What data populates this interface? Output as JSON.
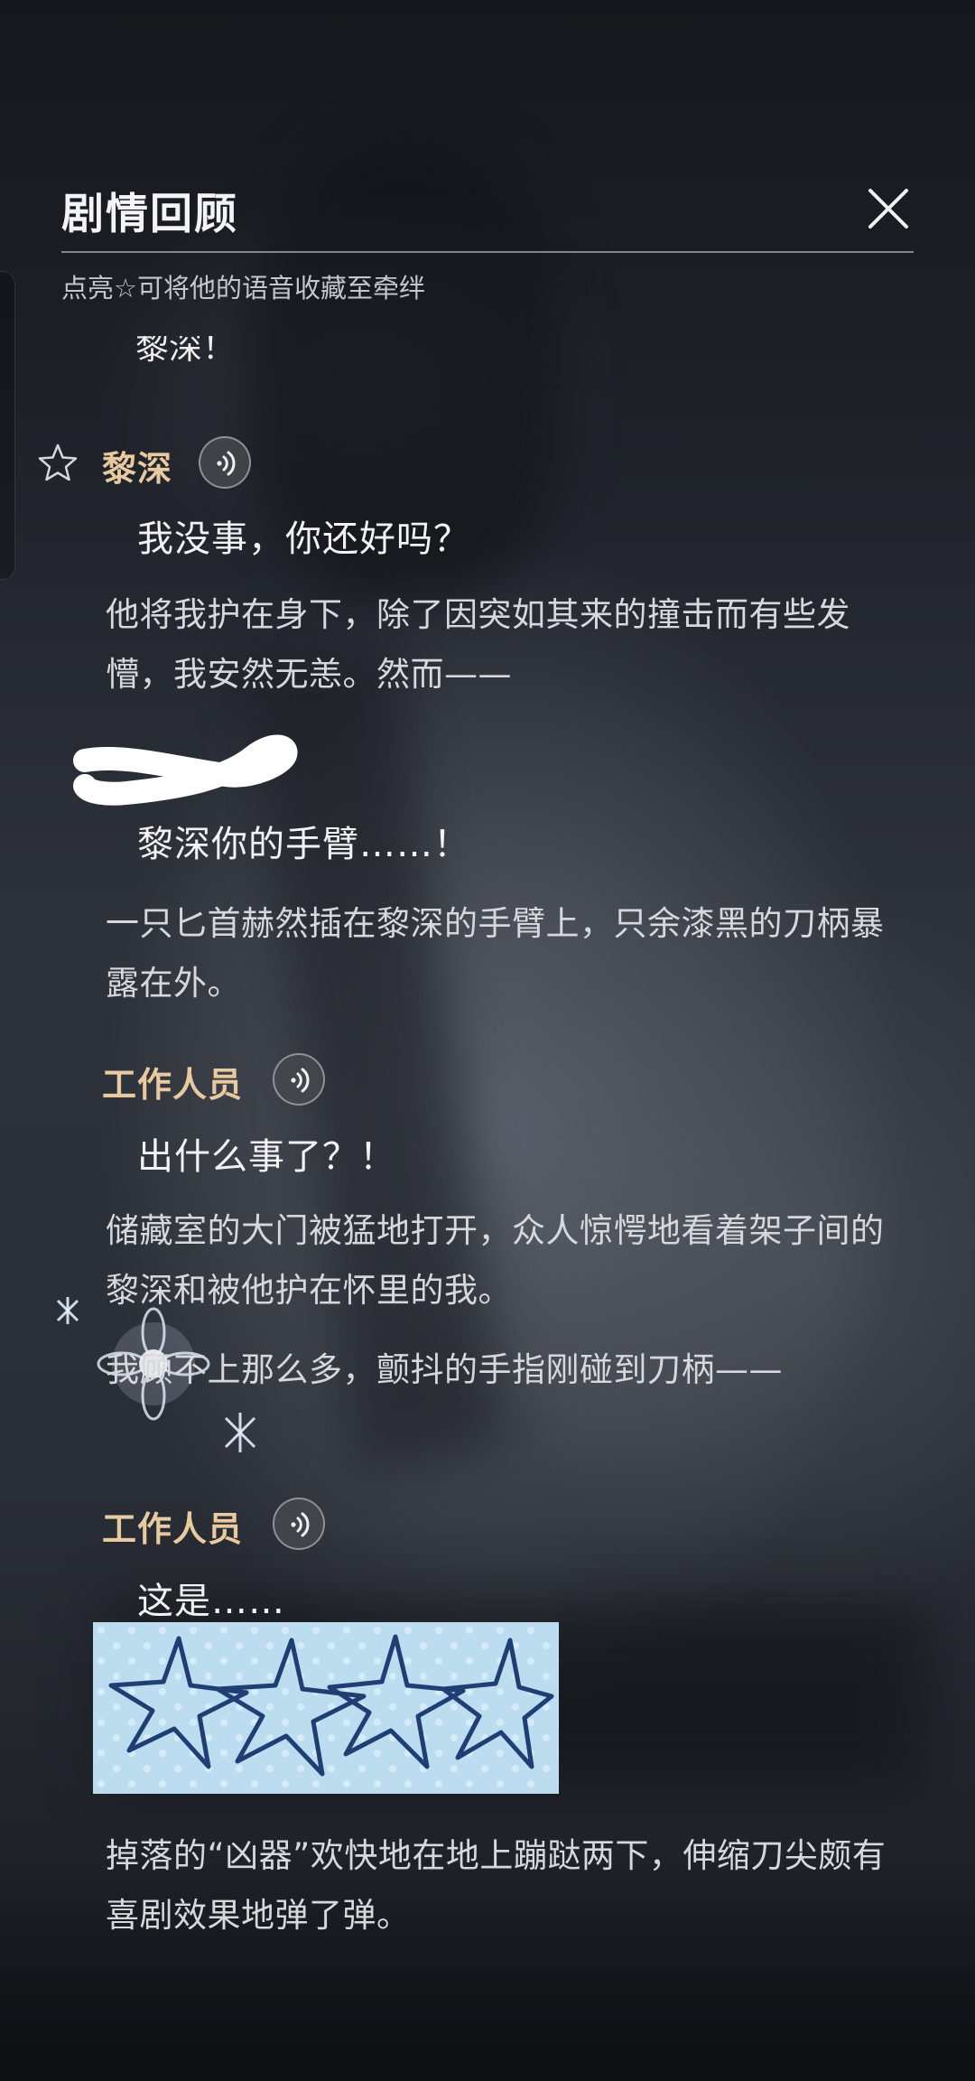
{
  "header": {
    "title": "剧情回顾",
    "hint": "点亮☆可将他的语音收藏至牵绊"
  },
  "cut_line": "黎深！",
  "entries": [
    {
      "speaker": "黎深",
      "dialogue": "我没事，你还好吗？"
    },
    {
      "narration": "他将我护在身下，除了因突如其来的撞击而有些发懵，我安然无恙。然而——"
    },
    {
      "dialogue": "黎深你的手臂……！"
    },
    {
      "narration": "一只匕首赫然插在黎深的手臂上，只余漆黑的刀柄暴露在外。"
    },
    {
      "speaker": "工作人员",
      "dialogue": "出什么事了？！"
    },
    {
      "narration": "储藏室的大门被猛地打开，众人惊愕地看着架子间的黎深和被他护在怀里的我。"
    },
    {
      "narration": "我顾不上那么多，颤抖的手指刚碰到刀柄——"
    },
    {
      "speaker": "工作人员",
      "dialogue": "这是……"
    },
    {
      "narration": "掉落的“凶器”欢快地在地上蹦跶两下，伸缩刀尖颇有喜剧效果地弹了弹。"
    }
  ],
  "icons": {
    "close": "close-icon",
    "star": "star-outline-icon",
    "voice": "voice-play-icon"
  },
  "colors": {
    "speaker": "#e8c9a0",
    "text": "#f3f3f5",
    "narration": "#d7d8dc"
  }
}
